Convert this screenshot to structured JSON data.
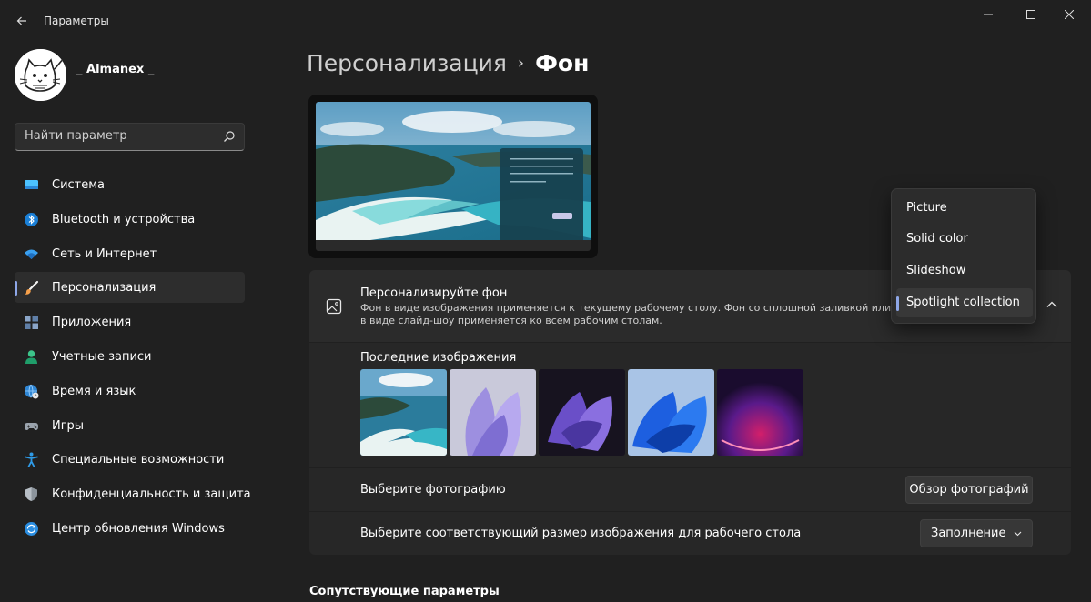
{
  "window": {
    "title": "Параметры"
  },
  "user": {
    "name": "_ Almanex _"
  },
  "search": {
    "placeholder": "Найти параметр"
  },
  "sidebar": {
    "items": [
      {
        "label": "Система",
        "icon": "monitor-icon"
      },
      {
        "label": "Bluetooth и устройства",
        "icon": "bluetooth-icon"
      },
      {
        "label": "Сеть и Интернет",
        "icon": "wifi-icon"
      },
      {
        "label": "Персонализация",
        "icon": "brush-icon",
        "active": true
      },
      {
        "label": "Приложения",
        "icon": "apps-icon"
      },
      {
        "label": "Учетные записи",
        "icon": "person-icon"
      },
      {
        "label": "Время и язык",
        "icon": "globe-clock-icon"
      },
      {
        "label": "Игры",
        "icon": "gamepad-icon"
      },
      {
        "label": "Специальные возможности",
        "icon": "accessibility-icon"
      },
      {
        "label": "Конфиденциальность и защита",
        "icon": "shield-icon"
      },
      {
        "label": "Центр обновления Windows",
        "icon": "update-icon"
      }
    ]
  },
  "breadcrumb": {
    "parent": "Персонализация",
    "separator": "›",
    "current": "Фон"
  },
  "background_card": {
    "title": "Персонализируйте фон",
    "description": "Фон в виде изображения применяется к текущему рабочему столу. Фон со сплошной заливкой или в виде слайд-шоу применяется ко всем рабочим столам."
  },
  "recent": {
    "label": "Последние изображения",
    "images": [
      "beach-landscape",
      "purple-bloom-light",
      "purple-bloom-dark",
      "blue-bloom",
      "red-glow"
    ]
  },
  "choose_photo": {
    "label": "Выберите фотографию",
    "button": "Обзор фотографий"
  },
  "fit": {
    "label": "Выберите соответствующий размер изображения для рабочего стола",
    "value": "Заполнение"
  },
  "related": {
    "title": "Сопутствующие параметры"
  },
  "dropdown": {
    "options": [
      "Picture",
      "Solid color",
      "Slideshow",
      "Spotlight collection"
    ],
    "selected": "Spotlight collection"
  },
  "colors": {
    "background": "#202020",
    "card": "#2b2b2b",
    "accent": "#8ea7e8"
  }
}
